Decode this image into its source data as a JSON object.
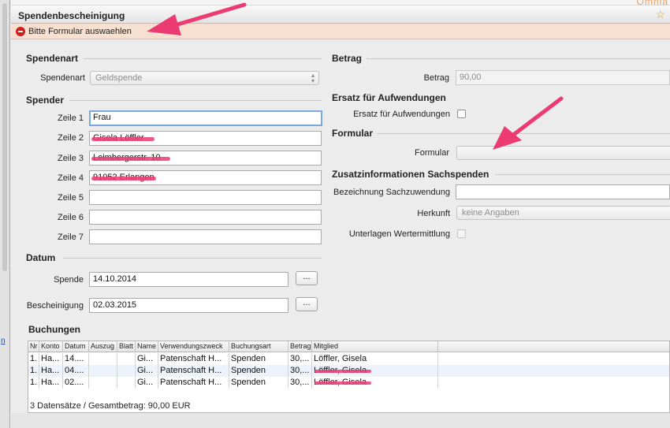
{
  "window": {
    "title": "Spendenbescheinigung",
    "brand_fragment": "Omnia",
    "star_icon": "star-icon",
    "message": "Bitte Formular auswaehlen",
    "left_link_fragment": "n"
  },
  "spendenart": {
    "section": "Spendenart",
    "label": "Spendenart",
    "value": "Geldspende"
  },
  "spender": {
    "section": "Spender",
    "lines": [
      {
        "label": "Zeile 1",
        "value": "Frau"
      },
      {
        "label": "Zeile 2",
        "value": "Gisela Löffler"
      },
      {
        "label": "Zeile 3",
        "value": "Leimbergerstr. 10"
      },
      {
        "label": "Zeile 4",
        "value": "91052 Erlangen"
      },
      {
        "label": "Zeile 5",
        "value": ""
      },
      {
        "label": "Zeile 6",
        "value": ""
      },
      {
        "label": "Zeile 7",
        "value": ""
      }
    ]
  },
  "datum": {
    "section": "Datum",
    "spende_label": "Spende",
    "spende_value": "14.10.2014",
    "bescheinigung_label": "Bescheinigung",
    "bescheinigung_value": "02.03.2015",
    "button_label": "..."
  },
  "betrag": {
    "section": "Betrag",
    "label": "Betrag",
    "value": "90,00"
  },
  "ersatz": {
    "section": "Ersatz für Aufwendungen",
    "label": "Ersatz für Aufwendungen"
  },
  "formular": {
    "section": "Formular",
    "label": "Formular",
    "value": ""
  },
  "zusatz": {
    "section": "Zusatzinformationen Sachspenden",
    "bezeichnung_label": "Bezeichnung Sachzuwendung",
    "bezeichnung_value": "",
    "herkunft_label": "Herkunft",
    "herkunft_value": "keine Angaben",
    "unterlagen_label": "Unterlagen Wertermittlung"
  },
  "buchungen": {
    "title": "Buchungen",
    "columns": [
      "Nr",
      "Konto",
      "Datum",
      "Auszug",
      "Blatt",
      "Name",
      "Verwendungszweck",
      "Buchungsart",
      "Betrag",
      "Mitglied"
    ],
    "rows": [
      [
        "1.",
        "Ha...",
        "14....",
        "",
        "",
        "Gi...",
        "Patenschaft H...",
        "Spenden",
        "30,...",
        "Löffler, Gisela"
      ],
      [
        "1.",
        "Ha...",
        "04....",
        "",
        "",
        "Gi...",
        "Patenschaft H...",
        "Spenden",
        "30,...",
        "Löffler, Gisela"
      ],
      [
        "1.",
        "Ha...",
        "02....",
        "",
        "",
        "Gi...",
        "Patenschaft H...",
        "Spenden",
        "30,...",
        "Löffler, Gisela"
      ]
    ],
    "summary": "3 Datensätze / Gesamtbetrag: 90,00 EUR"
  },
  "colors": {
    "message_bg": "#f8e0d0",
    "error_icon": "#cf2020",
    "annotation_arrow": "#ec3b71",
    "focus_border": "#7aa7e0"
  }
}
